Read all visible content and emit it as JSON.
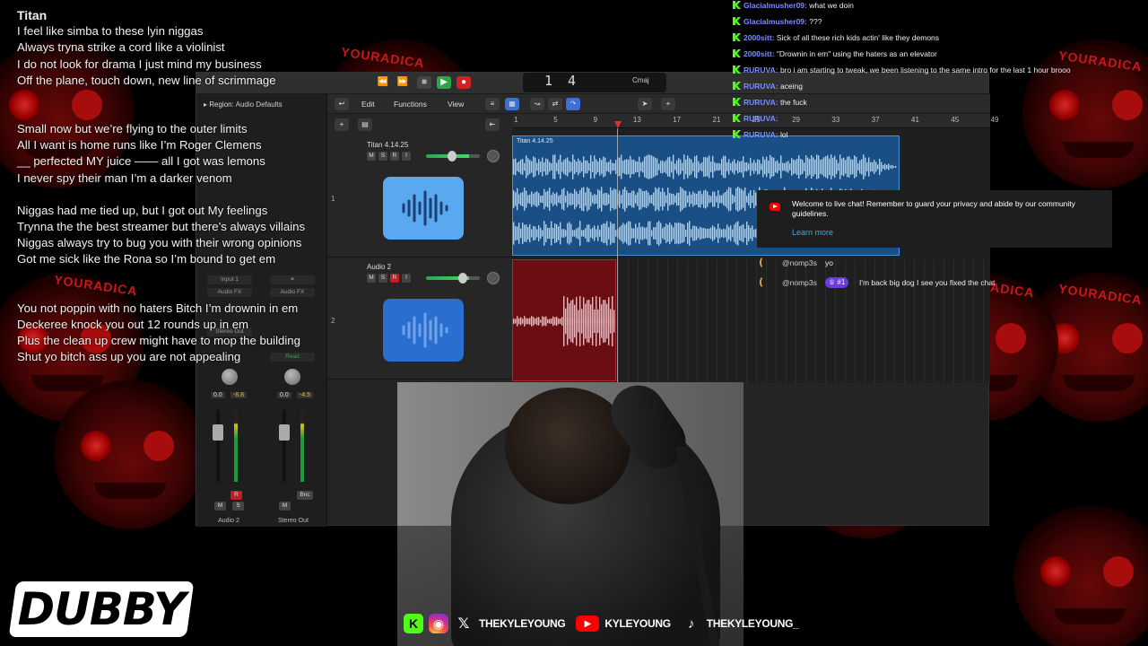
{
  "lyrics": {
    "title": "Titan",
    "stanza1": [
      "I feel like simba to these lyin niggas",
      "Always tryna strike a cord like a violinist",
      "I do not look for drama I just mind my business",
      "Off the plane, touch down, new line of scrimmage"
    ],
    "stanza2": [
      "Small now but we’re flying to the outer limits",
      "All I want is home runs like I’m Roger Clemens",
      "__ perfected MY juice —— all I got was lemons",
      "I never spy  their man I’m a darker venom"
    ],
    "stanza3": [
      "Niggas had me tied up, but I got out My feelings",
      "Trynna the the best streamer  but there’s always villains",
      "Niggas always try to bug you with their wrong opinions",
      "Got me sick like the Rona so I’m bound to get em"
    ],
    "stanza4": [
      "You not poppin with no haters Bitch I’m drownin in em",
      "Deckeree knock you out 12 rounds up in em",
      "Plus the clean up crew might have to mop the building",
      "Shut yo bitch ass up you are not appealing"
    ]
  },
  "chat": [
    {
      "user": "Glacialmusher09:",
      "text": "what we doin"
    },
    {
      "user": "Glacialmusher09:",
      "text": "???"
    },
    {
      "user": "2000sitt:",
      "text": "Sick of all these rich kids actin' like they demons"
    },
    {
      "user": "2000sitt:",
      "text": "\"Drownin in em\" using the haters as an elevator"
    },
    {
      "user": "RURUVA:",
      "text": "bro i am starting to tweak, we been listening to the same intro for the last 1 hour brooo"
    },
    {
      "user": "RURUVA:",
      "text": "aceing"
    },
    {
      "user": "RURUVA:",
      "text": "the fuck"
    },
    {
      "user": "RURUVA:",
      "text": ""
    },
    {
      "user": "RURUVA:",
      "text": "lol"
    }
  ],
  "youtube": {
    "notice": "Welcome to live chat! Remember to guard your privacy and abide by our community guidelines.",
    "learn_more": "Learn more",
    "messages": [
      {
        "user": "@nomp3s",
        "badge": "",
        "text": "yo"
      },
      {
        "user": "@nomp3s",
        "badge": "#1",
        "text": "I'm back big dog I see you fixed the chat"
      }
    ]
  },
  "daw": {
    "region_label": "Region:",
    "region_value": "Audio Defaults",
    "lcd_bar": "1",
    "lcd_beat": "4",
    "key": "Cmaj",
    "menus": {
      "edit": "Edit",
      "functions": "Functions",
      "view": "View"
    },
    "ruler": [
      "1",
      "5",
      "9",
      "13",
      "17",
      "21",
      "25",
      "29",
      "33",
      "37",
      "41",
      "45",
      "49"
    ],
    "tracks": [
      {
        "num": "1",
        "name": "Titan 4.14.25",
        "color": "#5aa8f0"
      },
      {
        "num": "2",
        "name": "Audio 2",
        "color": "#2a6fcf"
      }
    ],
    "region_name": "Titan 4.14.25",
    "inspector": {
      "input": "Input 1",
      "audio_fx": "Audio FX",
      "stereo_out": "Stereo Out",
      "read": "Read",
      "vol_left": "0.0",
      "vol_left2": "-8.8",
      "vol_right": "0.0",
      "vol_right2": "-4.5",
      "chan_left": "Audio 2",
      "chan_right": "Stereo Out",
      "bnc": "Bnc"
    }
  },
  "socials": {
    "twitter": "THEKYLEYOUNG",
    "youtube": "KYLEYOUNG",
    "tiktok": "THEKYLEYOUNG_"
  },
  "logo": "DUBBY",
  "bg_caption": "YOURADICA",
  "colors": {
    "kick": "#53fc18",
    "chat_user": "#7b8cff",
    "region_blue": "#1a4f86",
    "region_red": "#6a0e14",
    "yt_red": "#ff0000"
  }
}
